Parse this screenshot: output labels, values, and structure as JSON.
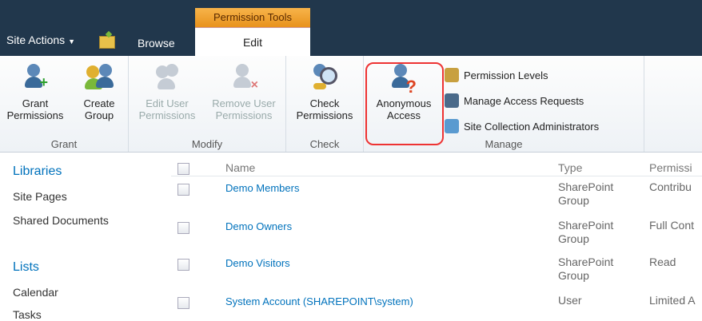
{
  "context_tab_header": "Permission Tools",
  "site_actions": "Site Actions",
  "tabs": {
    "browse": "Browse",
    "edit": "Edit"
  },
  "ribbon": {
    "grant": {
      "label": "Grant",
      "grant_permissions": [
        "Grant",
        "Permissions"
      ],
      "create_group": [
        "Create",
        "Group"
      ]
    },
    "modify": {
      "label": "Modify",
      "edit_user": [
        "Edit User",
        "Permissions"
      ],
      "remove_user": [
        "Remove User",
        "Permissions"
      ]
    },
    "check": {
      "label": "Check",
      "check_permissions": [
        "Check",
        "Permissions"
      ]
    },
    "manage": {
      "label": "Manage",
      "anonymous_access": [
        "Anonymous",
        "Access"
      ],
      "permission_levels": "Permission Levels",
      "manage_access_requests": "Manage Access Requests",
      "site_collection_admins": "Site Collection Administrators"
    }
  },
  "nav": {
    "libraries_heading": "Libraries",
    "site_pages": "Site Pages",
    "shared_documents": "Shared Documents",
    "lists_heading": "Lists",
    "calendar": "Calendar",
    "tasks": "Tasks"
  },
  "table": {
    "headers": {
      "name": "Name",
      "type": "Type",
      "permissions": "Permissi"
    },
    "rows": [
      {
        "name": "Demo Members",
        "type": [
          "SharePoint",
          "Group"
        ],
        "perm": "Contribu"
      },
      {
        "name": "Demo Owners",
        "type": [
          "SharePoint",
          "Group"
        ],
        "perm": "Full Cont"
      },
      {
        "name": "Demo Visitors",
        "type": [
          "SharePoint",
          "Group"
        ],
        "perm": "Read"
      },
      {
        "name": "System Account (SHAREPOINT\\system)",
        "type": [
          "User",
          ""
        ],
        "perm": "Limited A"
      }
    ]
  }
}
